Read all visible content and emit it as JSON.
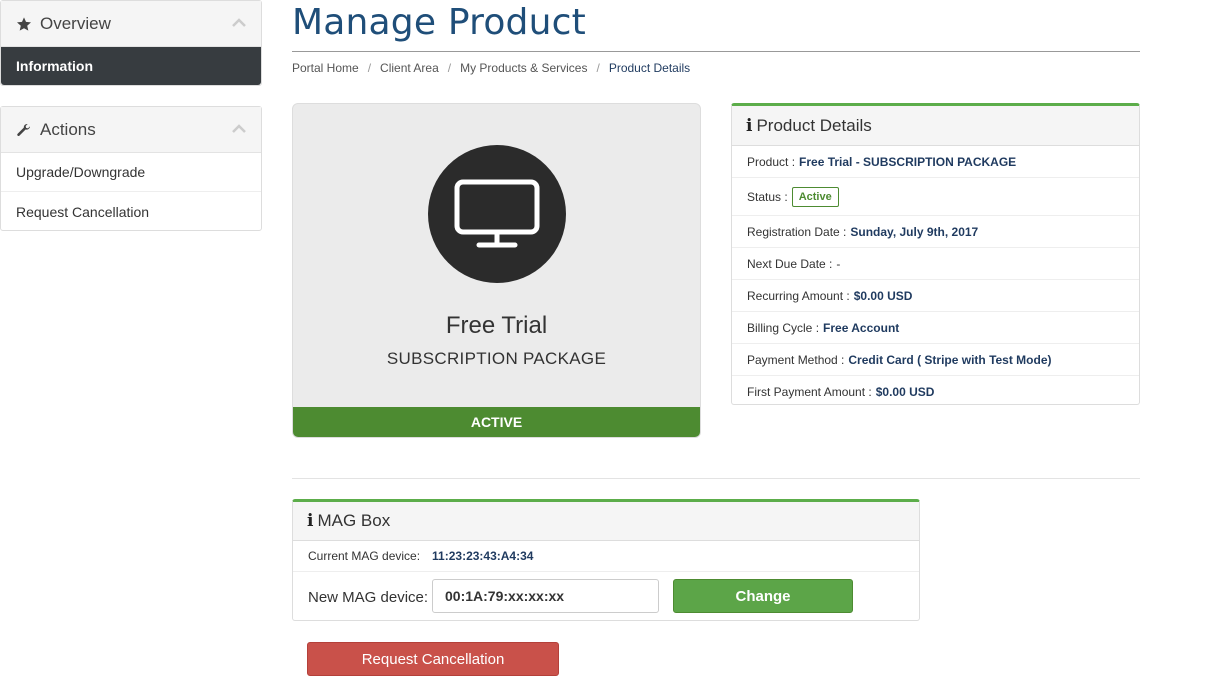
{
  "sidebar": {
    "overview": {
      "title": "Overview",
      "icon": "star-icon",
      "active_item": "Information"
    },
    "actions": {
      "title": "Actions",
      "icon": "wrench-icon",
      "items": [
        "Upgrade/Downgrade",
        "Request Cancellation"
      ]
    }
  },
  "header": {
    "title": "Manage Product",
    "breadcrumb": [
      "Portal Home",
      "Client Area",
      "My Products & Services",
      "Product Details"
    ]
  },
  "product": {
    "icon": "monitor-icon",
    "name": "Free Trial",
    "group": "SUBSCRIPTION PACKAGE",
    "status": "ACTIVE",
    "status_color": "#4d8b31"
  },
  "details": {
    "title": "Product Details",
    "product_label": "Product :",
    "product_value": "Free Trial - SUBSCRIPTION PACKAGE",
    "status_label": "Status :",
    "status_value": "Active",
    "registration_label": "Registration Date :",
    "registration_value": "Sunday, July 9th, 2017",
    "next_due_label": "Next Due Date :",
    "next_due_value": "-",
    "recurring_label": "Recurring Amount :",
    "recurring_value": "$0.00 USD",
    "billing_label": "Billing Cycle :",
    "billing_value": "Free Account",
    "payment_label": "Payment Method :",
    "payment_value": "Credit Card ( Stripe with Test Mode)",
    "first_payment_label": "First Payment Amount :",
    "first_payment_value": "$0.00 USD"
  },
  "mag": {
    "title": "MAG Box",
    "current_label": "Current MAG device:",
    "current_value": "11:23:23:43:A4:34",
    "new_label": "New MAG device:",
    "new_value": "00:1A:79:xx:xx:xx",
    "change_label": "Change"
  },
  "cancel_label": "Request Cancellation",
  "colors": {
    "accent_green": "#5cad4a",
    "danger": "#c9514a",
    "title_blue": "#1f4e79"
  }
}
